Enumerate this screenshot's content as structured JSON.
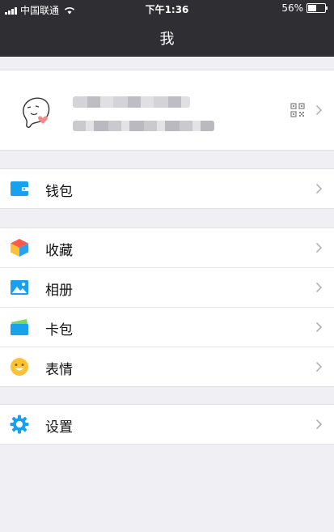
{
  "status_bar": {
    "carrier": "中国联通",
    "time": "下午1:36",
    "battery": "56%",
    "battery_level": 0.56
  },
  "header": {
    "title": "我"
  },
  "groups": [
    {
      "items": [
        {
          "label": "钱包",
          "icon": "wallet-icon"
        }
      ]
    },
    {
      "items": [
        {
          "label": "收藏",
          "icon": "favorites-cube-icon"
        },
        {
          "label": "相册",
          "icon": "album-photo-icon"
        },
        {
          "label": "卡包",
          "icon": "card-pack-icon"
        },
        {
          "label": "表情",
          "icon": "emoji-smile-icon"
        }
      ]
    },
    {
      "items": [
        {
          "label": "设置",
          "icon": "settings-gear-icon"
        }
      ]
    }
  ],
  "colors": {
    "header_bg": "#2f2f33",
    "page_bg": "#efeff4",
    "accent_blue": "#1aa1ee"
  }
}
